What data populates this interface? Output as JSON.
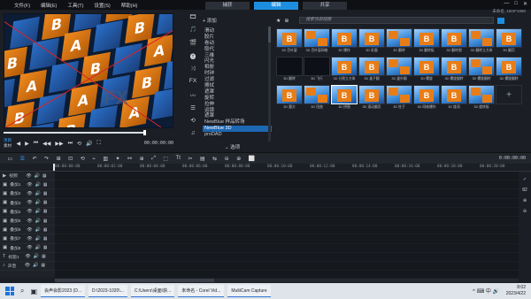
{
  "menu": [
    "文件(F)",
    "编辑(E)",
    "工具(T)",
    "设置(S)",
    "帮助(H)"
  ],
  "workspace_tabs": [
    {
      "label": "捕获",
      "active": false
    },
    {
      "label": "编辑",
      "active": true
    },
    {
      "label": "共享",
      "active": false
    }
  ],
  "window_controls": [
    "—",
    "□",
    "✕"
  ],
  "project_info": "未命名, 1920*1080",
  "preview": {
    "tile_letters": [
      "B",
      "A"
    ],
    "watermark": "FX"
  },
  "player": {
    "modes": [
      "项目",
      "素材"
    ],
    "buttons": [
      "◀",
      "▶",
      "⏮",
      "◀◀",
      "▶▶",
      "⏭",
      "⟲",
      "🔊",
      "⛶",
      "[",
      "]",
      "✂"
    ],
    "timecode": "00:00:00:00"
  },
  "library": {
    "side_icons": [
      "🎞",
      "🎵",
      "🎬",
      "🅣",
      "⤨",
      "FX",
      "〰",
      "☰",
      "⟲",
      "♫"
    ],
    "add_label": "+ 添加",
    "categories": [
      "滑动",
      "胶片",
      "卷动",
      "取代",
      "三维",
      "闪光",
      "相册",
      "时钟",
      "过滤",
      "擦拭",
      "遮罩",
      "旋转",
      "拉伸",
      "运镜",
      "遮罩",
      "NewBlue 样品转场",
      "NewBlue 3D",
      "proDAD"
    ],
    "selected_category_index": 16,
    "search_placeholder": "搜索当前视图",
    "filter_icons": [
      "★",
      "⊕"
    ],
    "thumbnails": [
      {
        "caption": "3D 百叶窗",
        "style": "blue"
      },
      {
        "caption": "3D 百叶窗网格",
        "style": "blue"
      },
      {
        "caption": "3D 爆炸",
        "style": "blue"
      },
      {
        "caption": "3D 彩蛋",
        "style": "blue"
      },
      {
        "caption": "3D 翻转",
        "style": "blue"
      },
      {
        "caption": "3D 翻转板",
        "style": "blue"
      },
      {
        "caption": "3D 翻转细",
        "style": "blue"
      },
      {
        "caption": "3D 翻转立方体",
        "style": "blue"
      },
      {
        "caption": "3D 翻页",
        "style": "blue"
      },
      {
        "caption": "3D 翻转",
        "style": "dark"
      },
      {
        "caption": "3D 飞行",
        "style": "dark"
      },
      {
        "caption": "3D 分割立方体",
        "style": "blue"
      },
      {
        "caption": "3D 盒子翻",
        "style": "blue"
      },
      {
        "caption": "3D 盒外翻",
        "style": "blue"
      },
      {
        "caption": "3D 螺旋",
        "style": "blue"
      },
      {
        "caption": "3D 螺旋翻转",
        "style": "blue"
      },
      {
        "caption": "3D 螺旋翻转",
        "style": "blue"
      },
      {
        "caption": "3D 螺旋翻转",
        "style": "blue"
      },
      {
        "caption": "3D 魔方",
        "style": "blue"
      },
      {
        "caption": "3D 扭曲",
        "style": "blue"
      },
      {
        "caption": "3D 拼图",
        "style": "blue"
      },
      {
        "caption": "3D 滚动翻页",
        "style": "blue"
      },
      {
        "caption": "3D 柱子",
        "style": "blue"
      },
      {
        "caption": "3D 网格爆炸",
        "style": "blue"
      },
      {
        "caption": "3D 旋涡",
        "style": "blue"
      },
      {
        "caption": "3D 旋转板",
        "style": "blue"
      }
    ],
    "selected_thumbnail_index": 20,
    "add_thumb_icon": "+",
    "options_label": "⌄ 选项"
  },
  "timeline_toolbar": {
    "buttons": [
      "▭",
      "☰",
      "↶",
      "↷",
      "⊞",
      "⊡",
      "⟲",
      "⌁",
      "▥",
      "✦",
      "⚯",
      "⊕",
      "⤢",
      "⬚",
      "Tt",
      "✂",
      "▤",
      "⇆",
      "⊖",
      "⊕",
      "⬜"
    ],
    "timecode": "0:00:00:00"
  },
  "ruler_ticks": [
    "00:00:00:00",
    "00:00:02:00",
    "00:00:04:00",
    "00:00:06:00",
    "00:00:08:00",
    "00:00:10:00",
    "00:00:12:00",
    "00:00:14:00",
    "00:00:16:00",
    "00:00:18:00",
    "00:00:20:00"
  ],
  "tracks": [
    {
      "icon": "▶",
      "label": "视频"
    },
    {
      "icon": "▣",
      "label": "叠加1"
    },
    {
      "icon": "▣",
      "label": "叠加2"
    },
    {
      "icon": "▣",
      "label": "叠加3"
    },
    {
      "icon": "▣",
      "label": "叠加4"
    },
    {
      "icon": "▣",
      "label": "叠加5"
    },
    {
      "icon": "▣",
      "label": "叠加6"
    },
    {
      "icon": "▣",
      "label": "叠加7"
    },
    {
      "icon": "▣",
      "label": "叠加8"
    },
    {
      "icon": "T",
      "label": "标题1"
    },
    {
      "icon": "♪",
      "label": "声音"
    }
  ],
  "right_tools": [
    "✓",
    "82",
    "⊕",
    "⊖"
  ],
  "taskbar": {
    "tasks": [
      "会声会影2023 (D...",
      "D:\\2023-1020\\...",
      "C:\\Users\\桌面\\获...",
      "未命名 - Corel Vid...",
      "MultiCam Capture"
    ],
    "tray": "^  ⌨  中  🔊",
    "time": "8:02",
    "date": "2023/4/22"
  }
}
